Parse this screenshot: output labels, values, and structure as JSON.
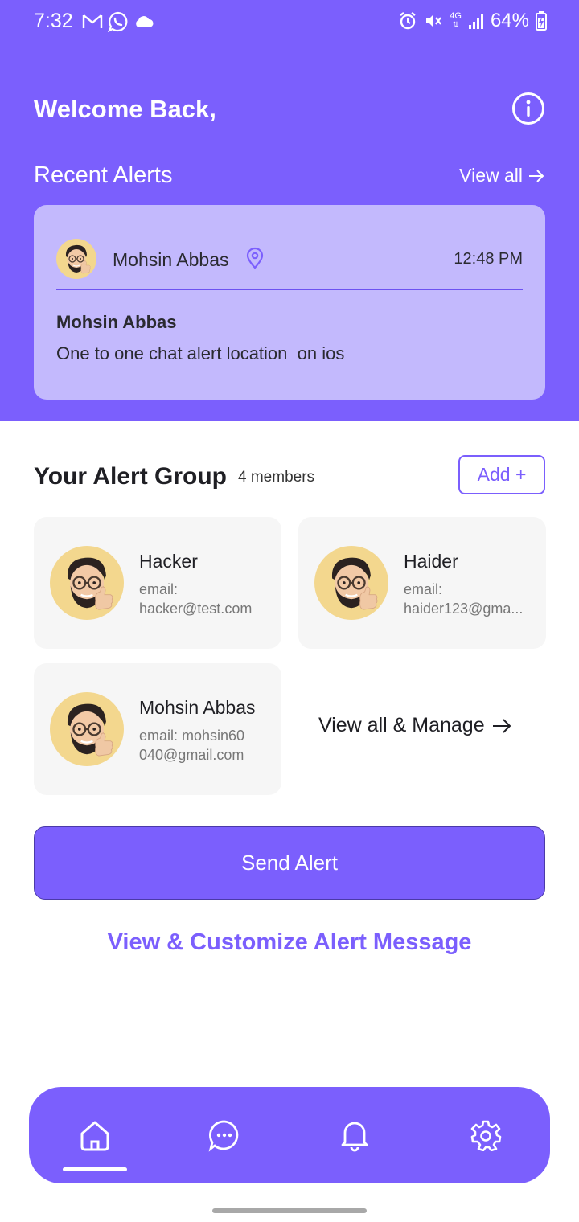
{
  "status_bar": {
    "time": "7:32",
    "battery": "64%",
    "network": "4G",
    "left_icons": [
      "gmail-icon",
      "whatsapp-icon",
      "cloud-icon"
    ],
    "right_icons": [
      "alarm-icon",
      "vibrate-icon",
      "network-4g-icon",
      "signal-icon",
      "battery-icon"
    ]
  },
  "header": {
    "welcome": "Welcome Back,",
    "info_icon": "info-icon",
    "recent_alerts_title": "Recent Alerts",
    "view_all_label": "View all"
  },
  "recent_alert": {
    "name": "Mohsin Abbas",
    "time": "12:48 PM",
    "sender": "Mohsin Abbas",
    "message": "One to one chat alert location  on ios"
  },
  "alert_group": {
    "title": "Your Alert Group",
    "member_count": "4 members",
    "add_label": "Add +",
    "members": [
      {
        "name": "Hacker",
        "email_label": "email:",
        "email": "hacker@test.com"
      },
      {
        "name": "Haider",
        "email_label": "email:",
        "email": "haider123@gma..."
      },
      {
        "name": "Mohsin Abbas",
        "email_line1": "email: mohsin60",
        "email_line2": "040@gmail.com"
      }
    ],
    "view_manage_label": "View all & Manage"
  },
  "actions": {
    "send_alert": "Send Alert",
    "customize": "View & Customize Alert Message"
  },
  "bottom_nav": {
    "items": [
      "home-icon",
      "chat-icon",
      "bell-icon",
      "settings-icon"
    ],
    "active": "home"
  },
  "colors": {
    "primary": "#7b5ffd",
    "card_light": "#c3b9fd",
    "member_card": "#f6f6f6",
    "text_dark": "#1f1f24"
  }
}
